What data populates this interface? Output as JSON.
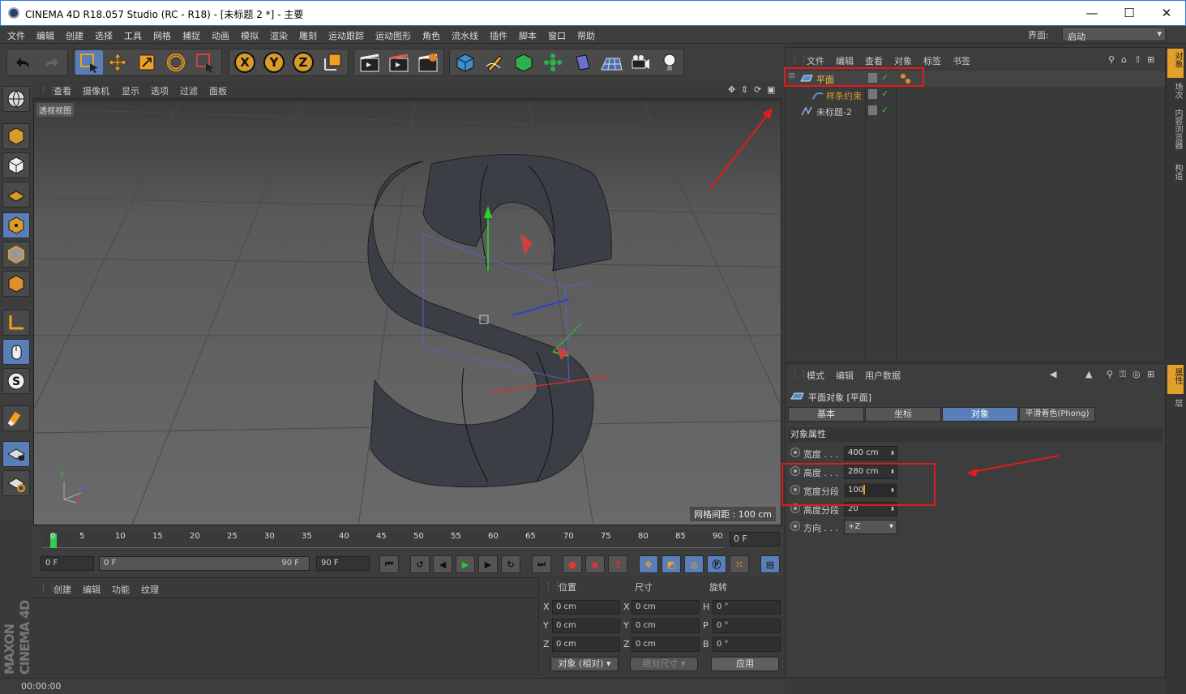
{
  "window": {
    "title": "CINEMA 4D R18.057 Studio (RC - R18) - [未标题 2 *] - 主要",
    "minimize": "—",
    "maximize": "☐",
    "close": "✕"
  },
  "menubar": {
    "items": [
      "文件",
      "编辑",
      "创建",
      "选择",
      "工具",
      "网格",
      "捕捉",
      "动画",
      "模拟",
      "渲染",
      "雕刻",
      "运动跟踪",
      "运动图形",
      "角色",
      "流水线",
      "插件",
      "脚本",
      "窗口",
      "帮助"
    ],
    "layout_label": "界面:",
    "layout_value": "启动"
  },
  "toolbar": {
    "axis_x": "X",
    "axis_y": "Y",
    "axis_z": "Z"
  },
  "viewport": {
    "menu": [
      "查看",
      "摄像机",
      "显示",
      "选项",
      "过滤",
      "面板"
    ],
    "label": "透视视图",
    "grid_spacing": "网格间距 : 100 cm",
    "axis_x": "X",
    "axis_y": "Y",
    "axis_z": "Z"
  },
  "timeline": {
    "ticks": [
      "0",
      "5",
      "10",
      "15",
      "20",
      "25",
      "30",
      "35",
      "40",
      "45",
      "50",
      "55",
      "60",
      "65",
      "70",
      "75",
      "80",
      "85",
      "90"
    ],
    "current_frame": "0 F"
  },
  "transport": {
    "start": "0 F",
    "range_start": "0 F",
    "range_end": "90 F",
    "end": "90 F"
  },
  "material_manager": {
    "menu": [
      "创建",
      "编辑",
      "功能",
      "纹理"
    ]
  },
  "coordinates": {
    "headers": [
      "位置",
      "尺寸",
      "旋转"
    ],
    "rows": [
      {
        "axis": "X",
        "pos": "0 cm",
        "size_axis": "X",
        "size": "0 cm",
        "rot_axis": "H",
        "rot": "0 °"
      },
      {
        "axis": "Y",
        "pos": "0 cm",
        "size_axis": "Y",
        "size": "0 cm",
        "rot_axis": "P",
        "rot": "0 °"
      },
      {
        "axis": "Z",
        "pos": "0 cm",
        "size_axis": "Z",
        "size": "0 cm",
        "rot_axis": "B",
        "rot": "0 °"
      }
    ],
    "mode": "对象 (相对)",
    "size_mode": "绝对尺寸",
    "apply": "应用"
  },
  "brand": "MAXON CINEMA 4D",
  "status": {
    "time": "00:00:00"
  },
  "object_manager": {
    "menu": [
      "文件",
      "编辑",
      "查看",
      "对象",
      "标签",
      "书签"
    ],
    "objects": [
      {
        "name": "平面",
        "color": "#f0c040"
      },
      {
        "name": "样条约束",
        "color": "#d89a30"
      },
      {
        "name": "未标题-2",
        "color": "#c8c8c8"
      }
    ]
  },
  "attribute_manager": {
    "menu": [
      "模式",
      "编辑",
      "用户数据"
    ],
    "object_title": "平面对象 [平面]",
    "tabs": [
      "基本",
      "坐标",
      "对象",
      "平滑着色(Phong)"
    ],
    "active_tab": "对象",
    "section": "对象属性",
    "props": [
      {
        "label": "宽度 . . .",
        "value": "400 cm"
      },
      {
        "label": "高度 . . .",
        "value": "280 cm"
      },
      {
        "label": "宽度分段",
        "value": "100"
      },
      {
        "label": "高度分段",
        "value": "20"
      },
      {
        "label": "方向 . . .",
        "value": "+Z"
      }
    ]
  },
  "right_tabs": [
    "对象",
    "场次",
    "内容浏览器",
    "构造",
    "属性",
    "层"
  ],
  "colors": {
    "accent": "#5a7fb8",
    "orange": "#e0a02a",
    "annotation": "#e21b1b"
  }
}
